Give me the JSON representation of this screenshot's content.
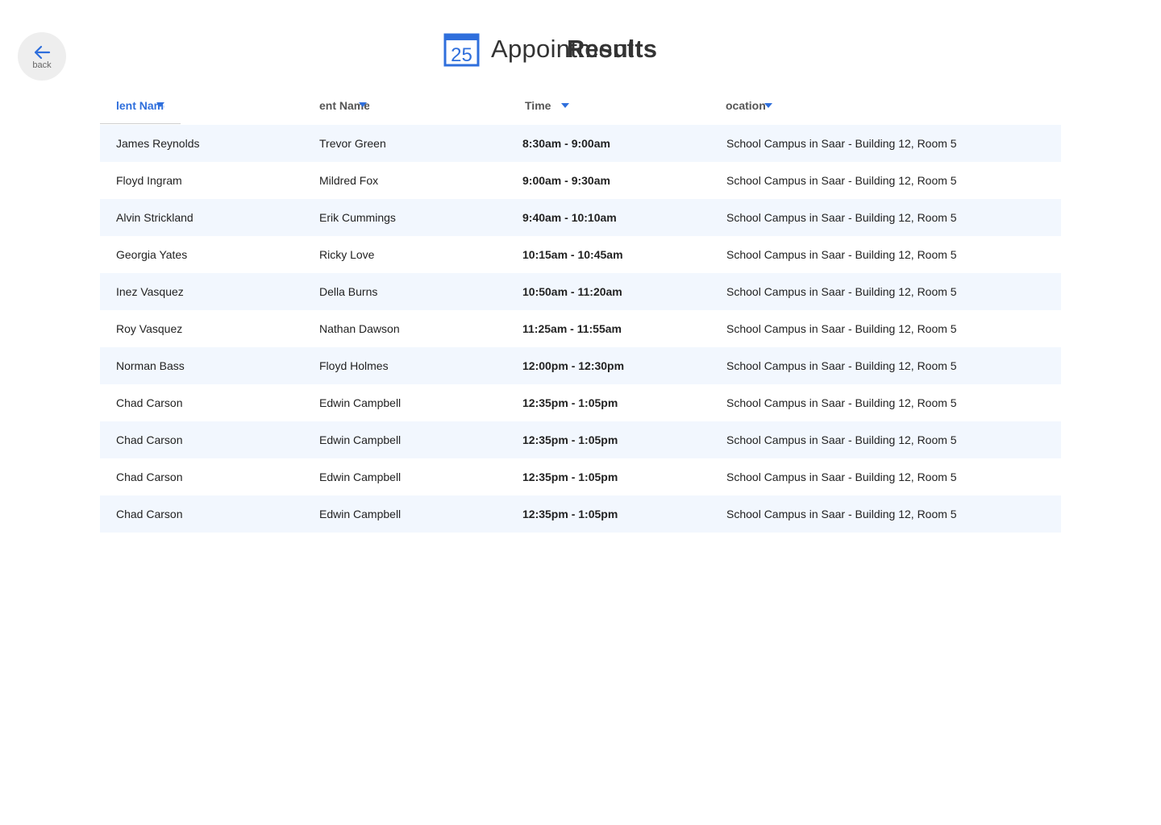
{
  "nav": {
    "back_label": "back"
  },
  "header": {
    "icon_day": "25",
    "title_underlay": "Appointment",
    "title_overlay": "Results",
    "accent_color": "#2f6fdc"
  },
  "table": {
    "columns": [
      {
        "label": "lent Name",
        "sorted": true
      },
      {
        "label": "ent Name",
        "sorted": false
      },
      {
        "label": "Time",
        "sorted": false
      },
      {
        "label": "ocation",
        "sorted": false
      }
    ],
    "rows": [
      {
        "student": "James Reynolds",
        "teacher": "Trevor Green",
        "time": "8:30am - 9:00am",
        "location": "School Campus in Saar - Building 12, Room 5"
      },
      {
        "student": "Floyd Ingram",
        "teacher": "Mildred Fox",
        "time": "9:00am - 9:30am",
        "location": "School Campus in Saar - Building 12, Room 5"
      },
      {
        "student": "Alvin Strickland",
        "teacher": "Erik Cummings",
        "time": "9:40am - 10:10am",
        "location": "School Campus in Saar - Building 12, Room 5"
      },
      {
        "student": "Georgia Yates",
        "teacher": "Ricky Love",
        "time": "10:15am - 10:45am",
        "location": "School Campus in Saar - Building 12, Room 5"
      },
      {
        "student": "Inez Vasquez",
        "teacher": "Della Burns",
        "time": "10:50am - 11:20am",
        "location": "School Campus in Saar - Building 12, Room 5"
      },
      {
        "student": "Roy Vasquez",
        "teacher": "Nathan Dawson",
        "time": "11:25am - 11:55am",
        "location": "School Campus in Saar - Building 12, Room 5"
      },
      {
        "student": "Norman Bass",
        "teacher": "Floyd Holmes",
        "time": "12:00pm - 12:30pm",
        "location": "School Campus in Saar - Building 12, Room 5"
      },
      {
        "student": "Chad Carson",
        "teacher": "Edwin Campbell",
        "time": "12:35pm - 1:05pm",
        "location": "School Campus in Saar - Building 12, Room 5"
      },
      {
        "student": "Chad Carson",
        "teacher": "Edwin Campbell",
        "time": "12:35pm - 1:05pm",
        "location": "School Campus in Saar - Building 12, Room 5"
      },
      {
        "student": "Chad Carson",
        "teacher": "Edwin Campbell",
        "time": "12:35pm - 1:05pm",
        "location": "School Campus in Saar - Building 12, Room 5"
      },
      {
        "student": "Chad Carson",
        "teacher": "Edwin Campbell",
        "time": "12:35pm - 1:05pm",
        "location": "School Campus in Saar - Building 12, Room 5"
      }
    ]
  }
}
